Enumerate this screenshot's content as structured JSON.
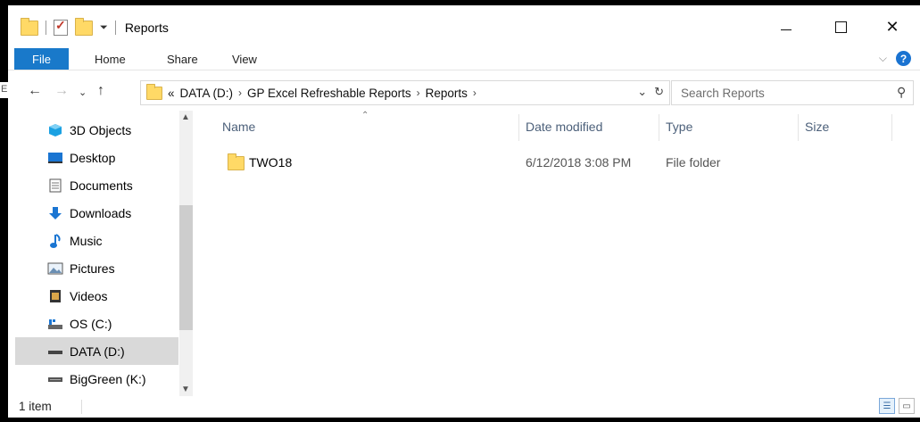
{
  "window": {
    "title": "Reports",
    "edge_letter": "E"
  },
  "ribbon": {
    "tabs": [
      "File",
      "Home",
      "Share",
      "View"
    ]
  },
  "address": {
    "prefix": "«",
    "crumbs": [
      "DATA (D:)",
      "GP Excel Refreshable Reports",
      "Reports"
    ],
    "search_placeholder": "Search Reports"
  },
  "nav": {
    "items": [
      {
        "label": "3D Objects",
        "icon": "3d-objects-icon",
        "color": "#1ba1e2"
      },
      {
        "label": "Desktop",
        "icon": "desktop-icon",
        "color": "#1a75d2"
      },
      {
        "label": "Documents",
        "icon": "documents-icon",
        "color": "#555555"
      },
      {
        "label": "Downloads",
        "icon": "downloads-icon",
        "color": "#1a75d2"
      },
      {
        "label": "Music",
        "icon": "music-icon",
        "color": "#1a75d2"
      },
      {
        "label": "Pictures",
        "icon": "pictures-icon",
        "color": "#555555"
      },
      {
        "label": "Videos",
        "icon": "videos-icon",
        "color": "#333333"
      },
      {
        "label": "OS (C:)",
        "icon": "os-drive-icon",
        "color": "#555555"
      },
      {
        "label": "DATA (D:)",
        "icon": "data-drive-icon",
        "color": "#555555",
        "selected": true
      },
      {
        "label": "BigGreen (K:)",
        "icon": "network-drive-icon",
        "color": "#555555"
      }
    ]
  },
  "columns": [
    "Name",
    "Date modified",
    "Type",
    "Size"
  ],
  "rows": [
    {
      "name": "TWO18",
      "date": "6/12/2018 3:08 PM",
      "type": "File folder",
      "size": ""
    }
  ],
  "status": {
    "count": "1 item"
  }
}
